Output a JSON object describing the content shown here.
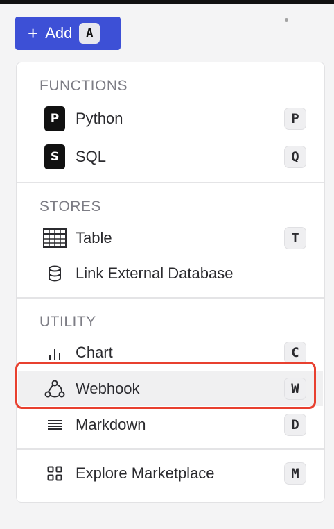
{
  "add_button": {
    "label": "Add",
    "shortcut": "A"
  },
  "menu": {
    "sections": [
      {
        "heading": "FUNCTIONS",
        "items": [
          {
            "label": "Python",
            "icon": "python-badge-icon",
            "badge": "P",
            "shortcut": "P"
          },
          {
            "label": "SQL",
            "icon": "sql-badge-icon",
            "badge": "S",
            "shortcut": "Q"
          }
        ]
      },
      {
        "heading": "STORES",
        "items": [
          {
            "label": "Table",
            "icon": "table-icon",
            "shortcut": "T"
          },
          {
            "label": "Link External Database",
            "icon": "database-icon",
            "shortcut": ""
          }
        ]
      },
      {
        "heading": "UTILITY",
        "items": [
          {
            "label": "Chart",
            "icon": "chart-icon",
            "shortcut": "C"
          },
          {
            "label": "Webhook",
            "icon": "webhook-icon",
            "shortcut": "W",
            "selected": true
          },
          {
            "label": "Markdown",
            "icon": "markdown-icon",
            "shortcut": "D"
          }
        ]
      },
      {
        "heading": "",
        "items": [
          {
            "label": "Explore Marketplace",
            "icon": "marketplace-grid-icon",
            "shortcut": "M"
          }
        ]
      }
    ]
  },
  "colors": {
    "accent": "#3d50d6",
    "highlight": "#e8402f"
  }
}
